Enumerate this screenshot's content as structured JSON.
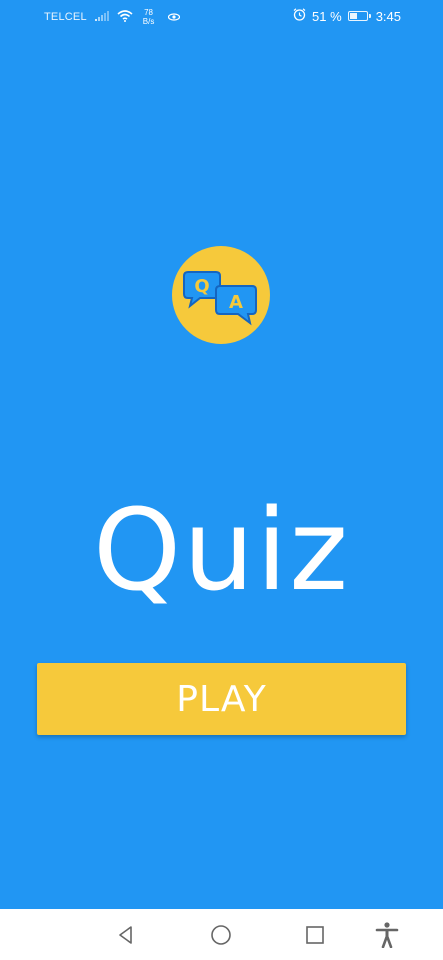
{
  "status_bar": {
    "carrier": "TELCEL",
    "speed_value": "78",
    "speed_unit": "B/s",
    "battery_percent": "51 %",
    "battery_level": 0.51,
    "time": "3:45"
  },
  "logo": {
    "question_letter": "Q",
    "answer_letter": "A"
  },
  "main": {
    "title": "Quiz",
    "play_label": "PLAY"
  },
  "colors": {
    "background": "#2196F3",
    "accent": "#F6C93B",
    "bubble_fill": "#2196F3",
    "bubble_outline": "#1565C0"
  },
  "nav": {
    "icons": [
      "back-icon",
      "home-icon",
      "recents-icon",
      "accessibility-icon"
    ]
  }
}
